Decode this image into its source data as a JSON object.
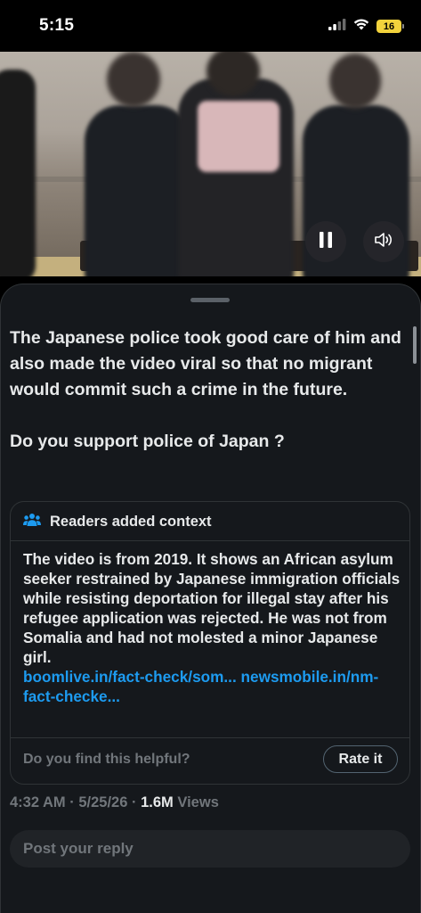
{
  "status_bar": {
    "time": "5:15",
    "battery": "16",
    "icons": [
      "cellular-signal-icon",
      "wifi-icon",
      "battery-charging-icon"
    ]
  },
  "video": {
    "controls": [
      "pause-icon",
      "volume-icon"
    ]
  },
  "post": {
    "paragraphs": [
      "The Japanese police took good care of him and also made the video viral so that no migrant would commit such a crime in the future.",
      "Do you support police of Japan ?"
    ]
  },
  "community_note": {
    "header": "Readers added context",
    "icon": "people-icon",
    "body": "The video is from 2019. It shows an African asylum seeker restrained by Japanese immigration officials while resisting deportation for illegal stay after his refugee application was rejected. He was not from Somalia and had not molested a minor Japanese girl.",
    "links": [
      "boomlive.in/fact-check/som...",
      "newsmobile.in/nm-fact-checke..."
    ],
    "helpful_question": "Do you find this helpful?",
    "rate_label": "Rate it"
  },
  "meta": {
    "time": "4:32 AM",
    "separator": "·",
    "date": "5/25/26",
    "views_count": "1.6M",
    "views_label": "Views"
  },
  "reply": {
    "placeholder": "Post your reply"
  },
  "colors": {
    "background": "#15181c",
    "text": "#e7e9ea",
    "muted": "#71767b",
    "link": "#1d9bf0",
    "note_icon": "#1d9bf0",
    "battery": "#f2d23c"
  }
}
